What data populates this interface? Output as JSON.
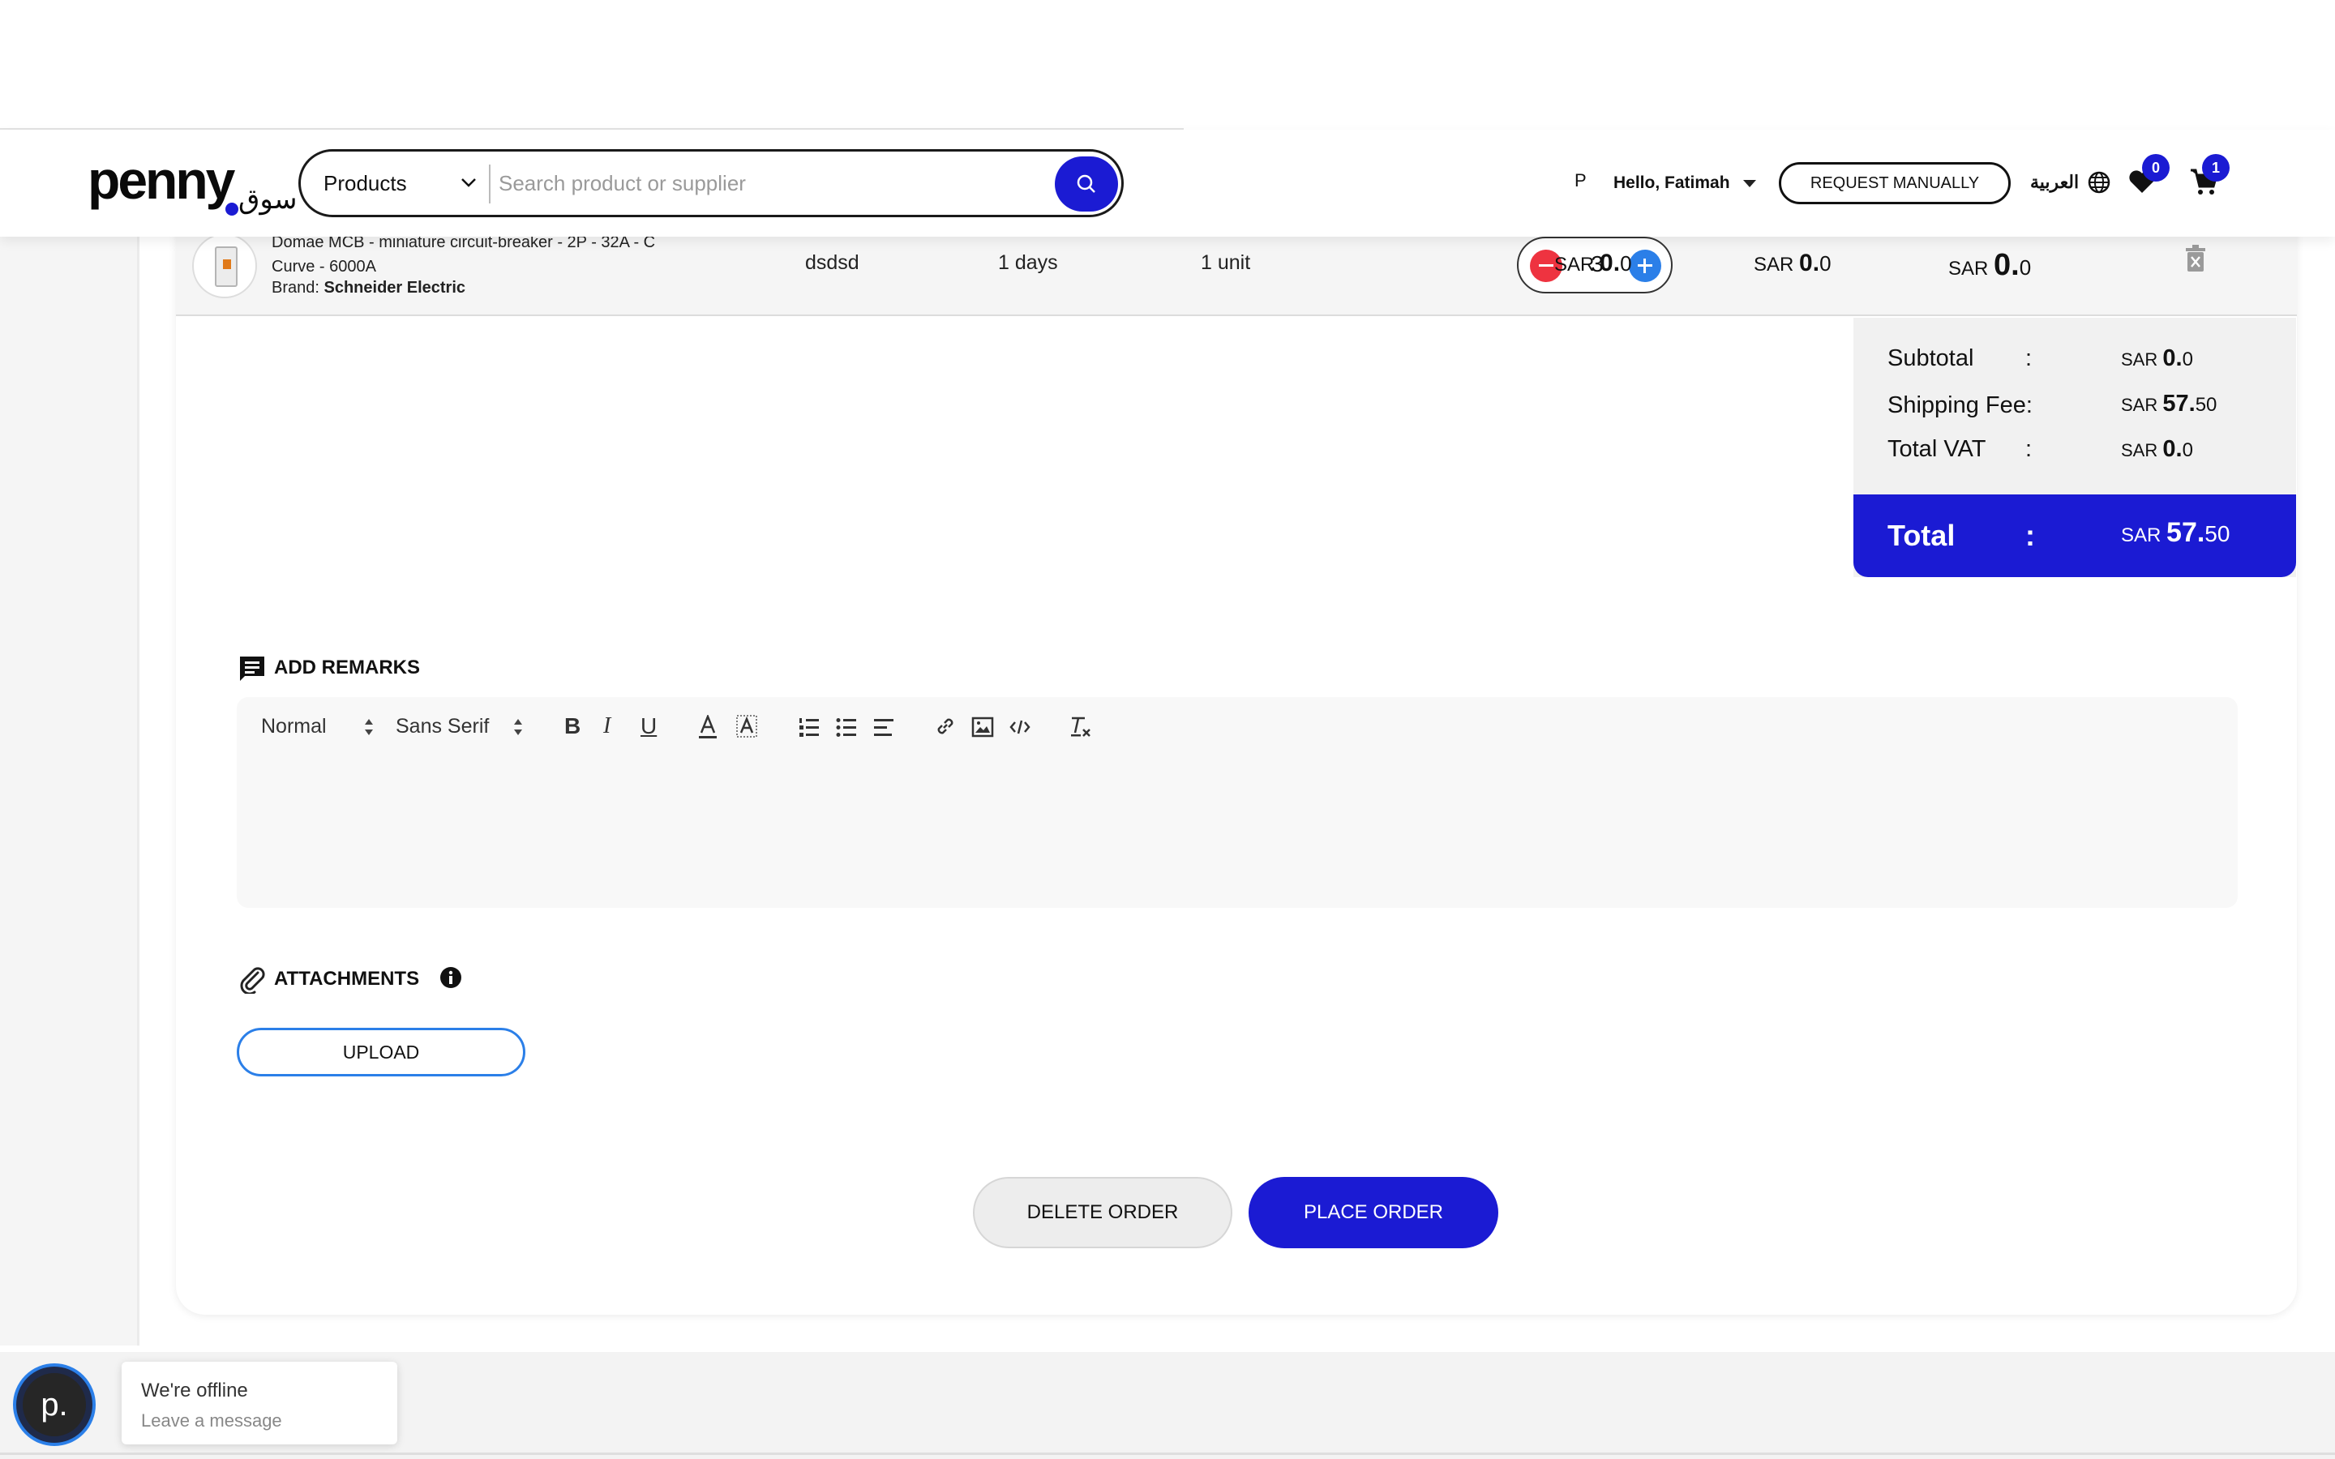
{
  "header": {
    "logo_text": "penny",
    "logo_arabic": "سوق",
    "search_category": "Products",
    "search_placeholder": "Search product or supplier",
    "user_initial": "P",
    "greeting": "Hello, Fatimah",
    "request_manually_label": "REQUEST MANUALLY",
    "language_label": "العربية",
    "wishlist_count": "0",
    "cart_count": "1"
  },
  "product": {
    "name": "Domae MCB - miniature circuit-breaker - 2P - 32A - C Curve - 6000A",
    "brand_label": "Brand:",
    "brand": "Schneider Electric",
    "supplier": "dsdsd",
    "lead_time": "1 days",
    "unit": "1 unit",
    "quantity": "3",
    "currency": "SAR",
    "unit_price_int": "0.",
    "unit_price_dec": "0",
    "vat_int": "0.",
    "vat_dec": "0",
    "total_int": "0.",
    "total_dec": "0"
  },
  "summary": {
    "currency": "SAR",
    "colon": ":",
    "subtotal_label": "Subtotal",
    "subtotal_int": "0.",
    "subtotal_dec": "0",
    "shipping_label": "Shipping Fee:",
    "shipping_int": "57.",
    "shipping_dec": "50",
    "vat_label": "Total VAT",
    "vat_int": "0.",
    "vat_dec": "0",
    "total_label": "Total",
    "total_int": "57.",
    "total_dec": "50"
  },
  "remarks": {
    "title": "ADD REMARKS",
    "format_select": "Normal",
    "font_select": "Sans Serif"
  },
  "attachments": {
    "title": "ATTACHMENTS",
    "upload_label": "UPLOAD"
  },
  "actions": {
    "delete_label": "DELETE ORDER",
    "place_label": "PLACE ORDER"
  },
  "chat": {
    "avatar_letter": "p.",
    "status": "We're offline",
    "subtext": "Leave a message"
  },
  "colors": {
    "primary": "#1b1bd3",
    "minus": "#ee3340",
    "plus": "#2b7fe8"
  }
}
